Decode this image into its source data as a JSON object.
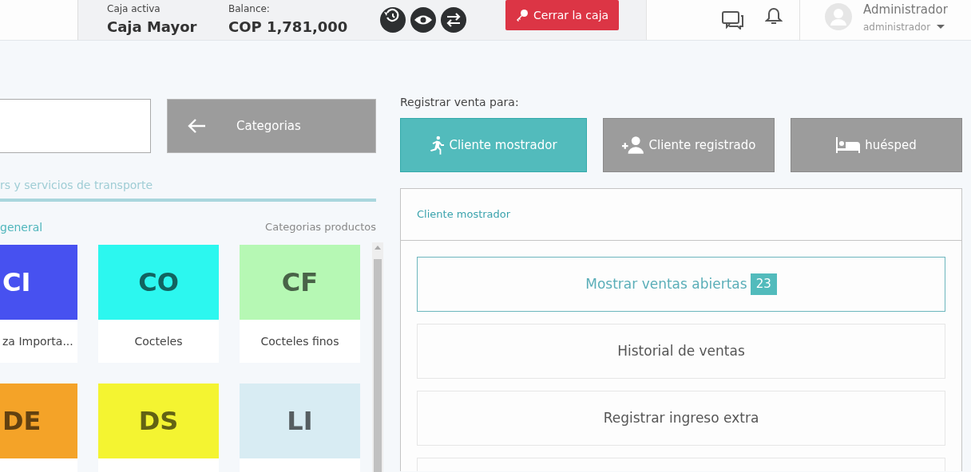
{
  "header": {
    "active_register_label": "Caja activa",
    "active_register": "Caja Mayor",
    "balance_label": "Balance:",
    "balance": "COP 1,781,000",
    "tools": [
      {
        "kind": "history"
      },
      {
        "kind": "view"
      },
      {
        "kind": "transfer"
      }
    ],
    "close_button": "Cerrar la caja",
    "user": {
      "name": "Administrador",
      "role": "administrador"
    }
  },
  "catalog": {
    "categories_button": "Categorias",
    "tab": "rs y servicios de transporte",
    "breadcrumb": "general",
    "section_title": "Categorias productos",
    "tiles": [
      {
        "initials": "CI",
        "label": "za Importa...",
        "color": "#4751f0"
      },
      {
        "initials": "CO",
        "label": "Cocteles",
        "color": "#2cf7ef"
      },
      {
        "initials": "CF",
        "label": "Cocteles finos",
        "color": "#b6f8b4"
      },
      {
        "initials": "DE",
        "color": "#f4a328"
      },
      {
        "initials": "DS",
        "color": "#f4f431"
      },
      {
        "initials": "LI",
        "color": "#d8ecf3"
      }
    ]
  },
  "sale": {
    "register_for_label": "Registrar venta para:",
    "customer_types": [
      {
        "kind": "walk-in",
        "label": "Cliente mostrador",
        "selected": true
      },
      {
        "kind": "registered",
        "label": "Cliente registrado",
        "selected": false
      },
      {
        "kind": "guest",
        "label": "huésped",
        "selected": false
      }
    ],
    "panel": {
      "title": "Cliente mostrador",
      "actions": [
        {
          "label": "Mostrar ventas abiertas",
          "badge": "23",
          "selected": true
        },
        {
          "label": "Historial de ventas",
          "selected": false
        },
        {
          "label": "Registrar ingreso extra",
          "selected": false
        }
      ]
    }
  }
}
